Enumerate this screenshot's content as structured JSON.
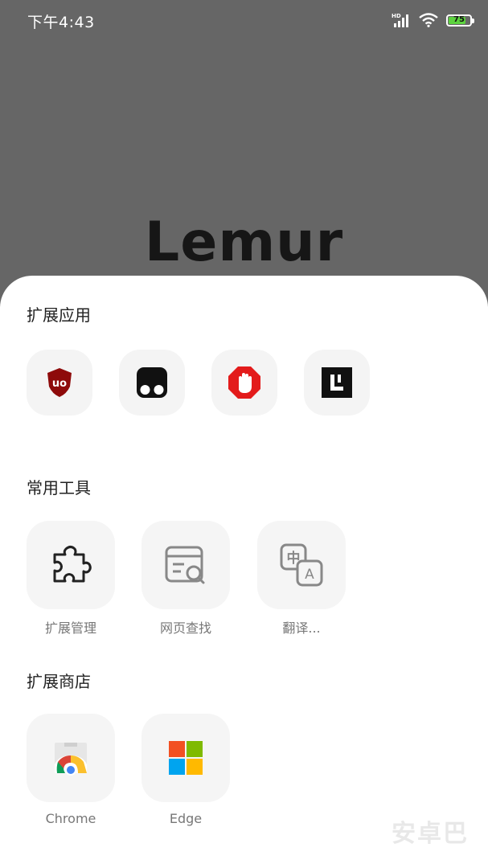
{
  "status": {
    "time": "下午4:43",
    "battery": "75"
  },
  "app": {
    "logo": "Lemur"
  },
  "sections": {
    "extensions_title": "扩展应用",
    "tools_title": "常用工具",
    "store_title": "扩展商店"
  },
  "extensions": [
    {
      "icon": "ublock-origin-icon"
    },
    {
      "icon": "tampermonkey-icon"
    },
    {
      "icon": "adblock-icon"
    },
    {
      "icon": "lemur-extension-icon"
    }
  ],
  "tools": [
    {
      "label": "扩展管理",
      "icon": "puzzle-icon"
    },
    {
      "label": "网页查找",
      "icon": "page-search-icon"
    },
    {
      "label": "翻译...",
      "icon": "translate-icon"
    }
  ],
  "stores": [
    {
      "label": "Chrome",
      "icon": "chrome-webstore-icon"
    },
    {
      "label": "Edge",
      "icon": "edge-store-icon"
    }
  ],
  "watermark": "安卓巴",
  "colors": {
    "overlay": "#666666",
    "sheet": "#ffffff",
    "tile": "#f4f4f4"
  }
}
